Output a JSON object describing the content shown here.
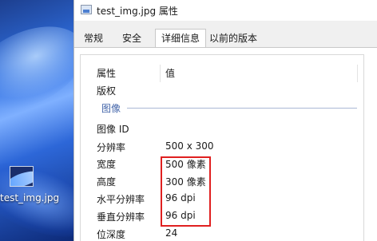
{
  "desktop": {
    "file_label": "test_img.jpg"
  },
  "window": {
    "title": "test_img.jpg 属性"
  },
  "tabs": [
    {
      "label": "常规"
    },
    {
      "label": "安全"
    },
    {
      "label": "详细信息",
      "selected": true
    },
    {
      "label": "以前的版本"
    }
  ],
  "details": {
    "header": {
      "property": "属性",
      "value": "值"
    },
    "top_rows": [
      {
        "key": "版权",
        "value": ""
      }
    ],
    "group_label": "图像",
    "rows": [
      {
        "key": "图像 ID",
        "value": ""
      },
      {
        "key": "分辨率",
        "value": "500 x 300"
      },
      {
        "key": "宽度",
        "value": "500 像素"
      },
      {
        "key": "高度",
        "value": "300 像素"
      },
      {
        "key": "水平分辨率",
        "value": "96 dpi"
      },
      {
        "key": "垂直分辨率",
        "value": "96 dpi"
      },
      {
        "key": "位深度",
        "value": "24"
      }
    ]
  },
  "colors": {
    "highlight_box": "#e02020",
    "group_label": "#4466aa"
  }
}
